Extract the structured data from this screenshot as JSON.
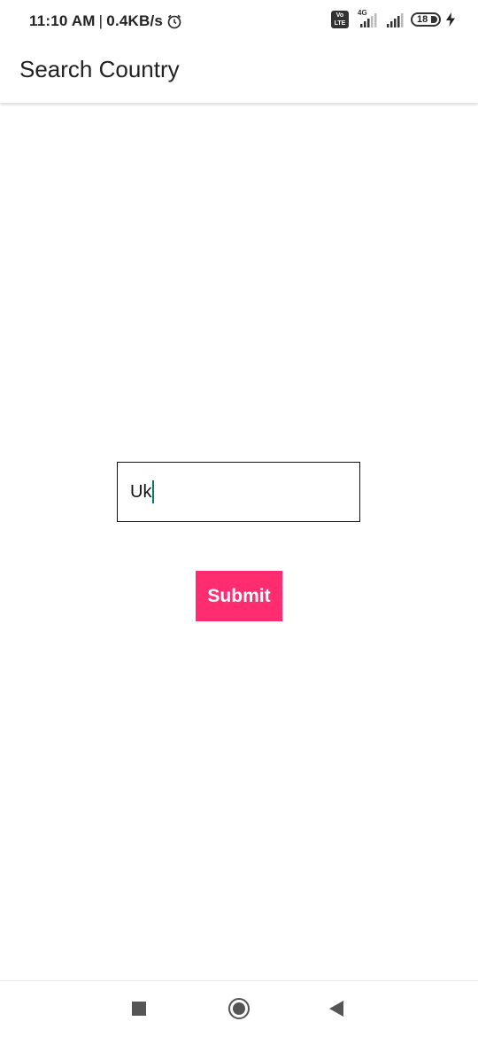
{
  "status_bar": {
    "time": "11:10 AM",
    "separator": "|",
    "network_speed": "0.4KB/s",
    "alarm_icon": "alarm-clock-icon",
    "volte_label_top": "Vo",
    "volte_label_bottom": "LTE",
    "network_type": "4G",
    "battery_level": "18",
    "charging_icon": "lightning-bolt-icon"
  },
  "app_bar": {
    "title": "Search Country"
  },
  "search": {
    "value": "Uk"
  },
  "submit_button": {
    "label": "Submit"
  },
  "colors": {
    "accent": "#ff2d6f",
    "cursor": "#0a7a6a",
    "text": "#212121"
  },
  "nav_bar": {
    "recent_icon": "square-recents-icon",
    "home_icon": "circle-home-icon",
    "back_icon": "triangle-back-icon"
  }
}
